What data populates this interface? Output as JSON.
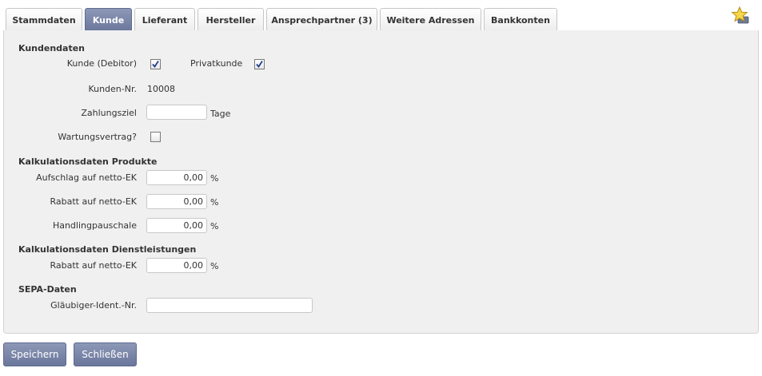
{
  "tabs": [
    {
      "label": "Stammdaten",
      "active": false
    },
    {
      "label": "Kunde",
      "active": true
    },
    {
      "label": "Lieferant",
      "active": false
    },
    {
      "label": "Hersteller",
      "active": false
    },
    {
      "label": "Ansprechpartner (3)",
      "active": false
    },
    {
      "label": "Weitere Adressen",
      "active": false
    },
    {
      "label": "Bankkonten",
      "active": false
    }
  ],
  "favorite_icon": "star-folder-icon",
  "kundendaten": {
    "heading": "Kundendaten",
    "kunde_debitor": {
      "label": "Kunde (Debitor)",
      "checked": true
    },
    "privatkunde": {
      "label": "Privatkunde",
      "checked": true
    },
    "kunden_nr": {
      "label": "Kunden-Nr.",
      "value": "10008"
    },
    "zahlungsziel": {
      "label": "Zahlungsziel",
      "value": "",
      "unit": "Tage"
    },
    "wartungsvertrag": {
      "label": "Wartungsvertrag?",
      "checked": false
    }
  },
  "kalkulation_produkte": {
    "heading": "Kalkulationsdaten Produkte",
    "aufschlag": {
      "label": "Aufschlag auf netto-EK",
      "value": "0,00",
      "unit": "%"
    },
    "rabatt": {
      "label": "Rabatt auf netto-EK",
      "value": "0,00",
      "unit": "%"
    },
    "handling": {
      "label": "Handlingpauschale",
      "value": "0,00",
      "unit": "%"
    }
  },
  "kalkulation_dienstleistungen": {
    "heading": "Kalkulationsdaten Dienstleistungen",
    "rabatt": {
      "label": "Rabatt auf netto-EK",
      "value": "0,00",
      "unit": "%"
    }
  },
  "sepa": {
    "heading": "SEPA-Daten",
    "glaeubiger": {
      "label": "Gläubiger-Ident.-Nr.",
      "value": ""
    }
  },
  "buttons": {
    "save": "Speichern",
    "close": "Schließen"
  },
  "colors": {
    "accent": "#7a86a8",
    "panel": "#f0f0f0"
  }
}
